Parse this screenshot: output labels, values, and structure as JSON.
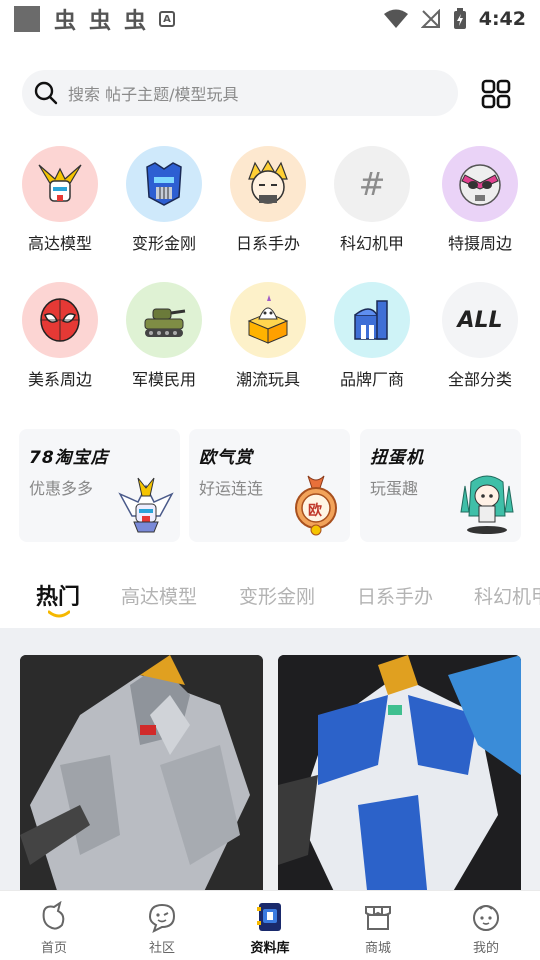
{
  "status_bar": {
    "app_glyphs": [
      "虫",
      "虫",
      "虫"
    ],
    "a_badge": "A",
    "time": "4:42"
  },
  "search": {
    "placeholder": "搜索 帖子主题/模型玩具"
  },
  "categories": [
    {
      "label": "高达模型",
      "icon": "gundam-icon",
      "color": "#fcd5d3"
    },
    {
      "label": "变形金刚",
      "icon": "transformer-icon",
      "color": "#cfe9fb"
    },
    {
      "label": "日系手办",
      "icon": "anime-figure-icon",
      "color": "#fde8cf"
    },
    {
      "label": "科幻机甲",
      "icon": "hash-icon",
      "color": "#f0f0f0",
      "glyph": "#"
    },
    {
      "label": "特摄周边",
      "icon": "kamen-rider-icon",
      "color": "#ead3f7"
    },
    {
      "label": "美系周边",
      "icon": "spiderman-icon",
      "color": "#fcd5d3"
    },
    {
      "label": "军模民用",
      "icon": "tank-icon",
      "color": "#dff2d4"
    },
    {
      "label": "潮流玩具",
      "icon": "trendy-toy-icon",
      "color": "#fdf1c9"
    },
    {
      "label": "品牌厂商",
      "icon": "factory-icon",
      "color": "#cff3f7"
    },
    {
      "label": "全部分类",
      "icon": "all-icon",
      "color": "#f3f4f6",
      "glyph": "ALL"
    }
  ],
  "promos": [
    {
      "title": "78淘宝店",
      "subtitle": "优惠多多",
      "icon": "gundam-head-icon"
    },
    {
      "title": "欧气赏",
      "subtitle": "好运连连",
      "icon": "lucky-medal-icon",
      "badge": "欧"
    },
    {
      "title": "扭蛋机",
      "subtitle": "玩蛋趣",
      "icon": "gacha-figure-icon"
    }
  ],
  "tabs": [
    "热门",
    "高达模型",
    "变形金刚",
    "日系手办",
    "科幻机甲"
  ],
  "active_tab": "热门",
  "feed": [
    {
      "image": "gundam-white-model-photo"
    },
    {
      "image": "gundam-blue-model-photo"
    }
  ],
  "bottom_nav": [
    {
      "label": "首页",
      "icon": "home-icon"
    },
    {
      "label": "社区",
      "icon": "community-icon"
    },
    {
      "label": "资料库",
      "icon": "library-icon",
      "active": true
    },
    {
      "label": "商城",
      "icon": "shop-icon"
    },
    {
      "label": "我的",
      "icon": "profile-icon"
    }
  ],
  "colors": {
    "accent": "#f5b800",
    "nav_active": "#1a2a6c",
    "search_bg": "#f3f4f6",
    "feed_bg": "#eef0f3"
  }
}
